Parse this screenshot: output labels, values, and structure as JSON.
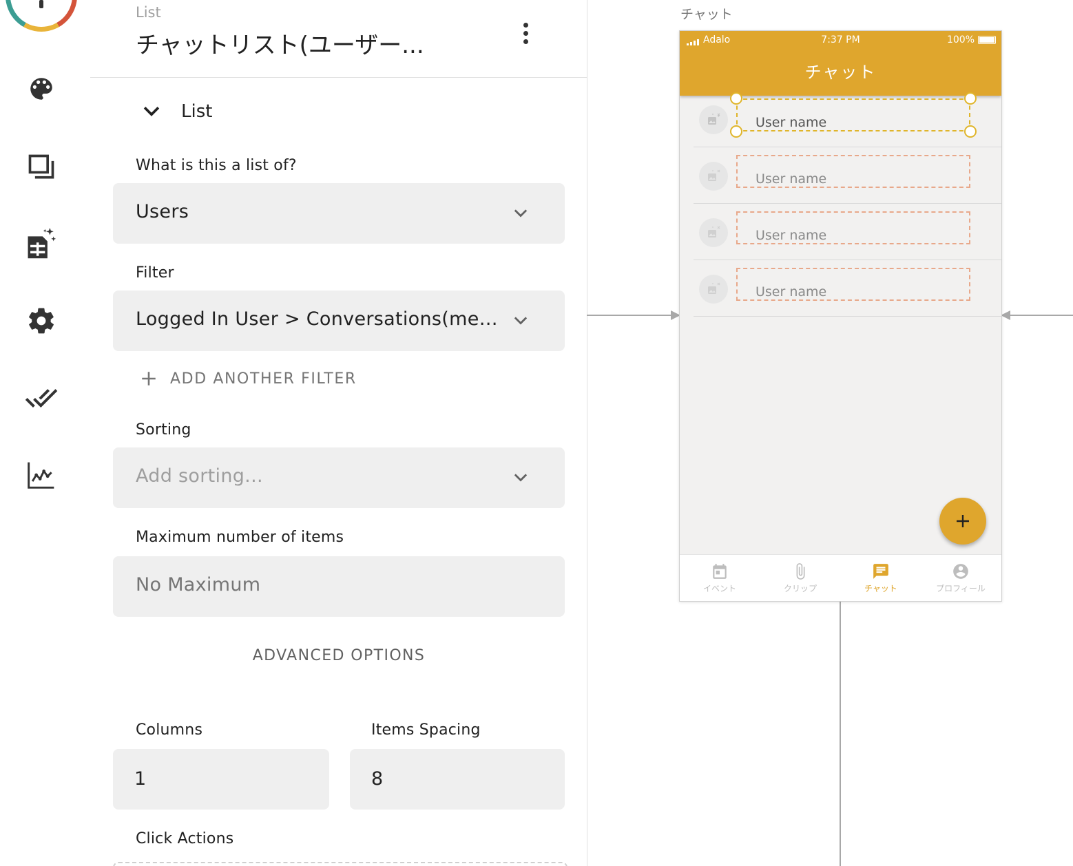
{
  "panel": {
    "breadcrumb": "List",
    "title": "チャットリスト(ユーザー...",
    "section_label": "List",
    "list_of_label": "What is this a list of?",
    "list_of_value": "Users",
    "filter_label": "Filter",
    "filter_value": "Logged In User > Conversations(mem...",
    "add_filter_label": "ADD ANOTHER FILTER",
    "sorting_label": "Sorting",
    "sorting_placeholder": "Add sorting...",
    "max_items_label": "Maximum number of items",
    "max_items_placeholder": "No Maximum",
    "advanced_label": "ADVANCED OPTIONS",
    "columns_label": "Columns",
    "columns_value": "1",
    "spacing_label": "Items Spacing",
    "spacing_value": "8",
    "click_actions_label": "Click Actions"
  },
  "rail": {
    "icons": [
      "palette-icon",
      "screens-icon",
      "database-icon",
      "gear-icon",
      "publish-check-icon",
      "analytics-icon"
    ]
  },
  "canvas": {
    "screen_label": "チャット",
    "status_bar": {
      "carrier": "Adalo",
      "time": "7:37 PM",
      "battery": "100%"
    },
    "app_bar_title": "チャット",
    "list_items": [
      "User name",
      "User name",
      "User name",
      "User name"
    ],
    "tabs": [
      {
        "label": "イベント",
        "icon": "calendar-icon",
        "active": false
      },
      {
        "label": "クリップ",
        "icon": "paperclip-icon",
        "active": false
      },
      {
        "label": "チャット",
        "icon": "chat-icon",
        "active": true
      },
      {
        "label": "プロフィール",
        "icon": "account-icon",
        "active": false
      }
    ],
    "fab_icon": "plus-icon"
  },
  "colors": {
    "accent": "#dfa62d",
    "selection": "#e0b52a",
    "placeholder_outline": "#e8a88a"
  }
}
